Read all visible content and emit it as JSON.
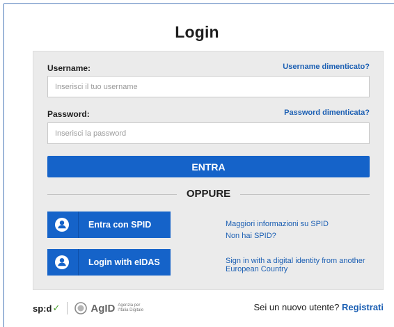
{
  "page": {
    "title": "Login"
  },
  "form": {
    "username_label": "Username:",
    "username_forgot_link": "Username dimenticato?",
    "username_placeholder": "Inserisci il tuo username",
    "username_value": "",
    "password_label": "Password:",
    "password_forgot_link": "Password dimenticata?",
    "password_placeholder": "Inserisci la password",
    "password_value": "",
    "submit_label": "ENTRA"
  },
  "divider": {
    "text": "OPPURE"
  },
  "identity_providers": [
    {
      "button_label": "Entra con SPID",
      "icon": "person-circle-icon",
      "links": [
        "Maggiori informazioni su SPID",
        "Non hai SPID?"
      ]
    },
    {
      "button_label": "Login with eIDAS",
      "icon": "person-circle-icon",
      "links": [
        "Sign in with a digital identity from another",
        "European Country"
      ]
    }
  ],
  "footer": {
    "spid_logo_text": "sp:d",
    "agid_logo_text": "AgID",
    "agid_subtext_line1": "Agenzia per",
    "agid_subtext_line2": "l'Italia Digitale",
    "new_user_text": "Sei un nuovo utente?",
    "register_link": "Registrati"
  },
  "colors": {
    "accent": "#1563c9",
    "link": "#1b5fb3",
    "panel_background": "#ebebeb",
    "spid_tick": "#4aa02c"
  }
}
